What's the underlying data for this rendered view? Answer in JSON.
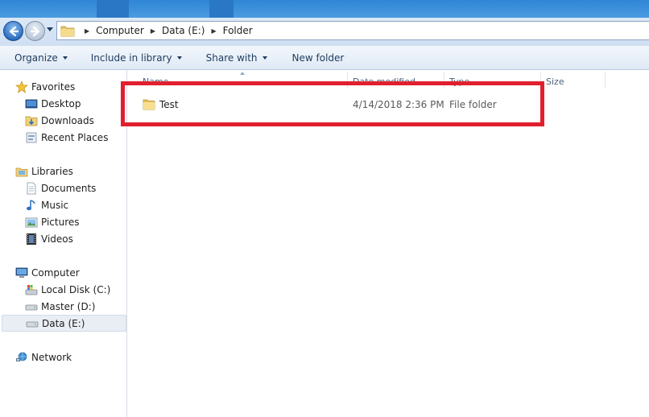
{
  "navigation": {
    "back_icon": "back-arrow-icon",
    "forward_icon": "forward-arrow-icon",
    "address_crumbs": [
      "Computer",
      "Data (E:)",
      "Folder"
    ]
  },
  "toolbar": {
    "organize": "Organize",
    "include_in_library": "Include in library",
    "share_with": "Share with",
    "new_folder": "New folder"
  },
  "sidebar": {
    "favorites": "Favorites",
    "desktop": "Desktop",
    "downloads": "Downloads",
    "recent_places": "Recent Places",
    "libraries": "Libraries",
    "documents": "Documents",
    "music": "Music",
    "pictures": "Pictures",
    "videos": "Videos",
    "computer": "Computer",
    "local_disk": "Local Disk (C:)",
    "master": "Master (D:)",
    "data": "Data (E:)",
    "network": "Network",
    "selected": "Data (E:)"
  },
  "columns": {
    "name": "Name",
    "date_modified": "Date modified",
    "type": "Type",
    "size": "Size"
  },
  "files": [
    {
      "name": "Test",
      "date_modified": "4/14/2018 2:36 PM",
      "type": "File folder",
      "size": ""
    }
  ],
  "colors": {
    "highlight_border": "#e0202e",
    "title_bar": "#2f86d6",
    "selected_bg": "#e9eef4"
  }
}
